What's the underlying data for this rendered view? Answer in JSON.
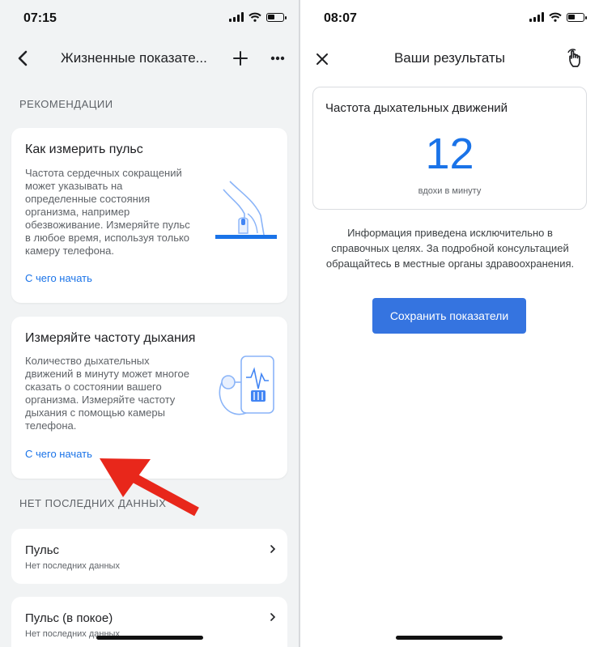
{
  "left_screen": {
    "status": {
      "time": "07:15"
    },
    "appbar": {
      "title": "Жизненные показате..."
    },
    "recommendations": {
      "label": "РЕКОМЕНДАЦИИ",
      "cards": [
        {
          "title": "Как измерить пульс",
          "body": "Частота сердечных сокращений может указывать на определенные состояния организма, например обезвоживание. Измеряйте пульс в любое время, используя только камеру телефона.",
          "link": "С чего начать"
        },
        {
          "title": "Измеряйте частоту дыхания",
          "body": "Количество дыхательных движений в минуту может многое сказать о состоянии вашего организма. Измеряйте частоту дыхания с помощью камеры телефона.",
          "link": "С чего начать"
        }
      ]
    },
    "recent": {
      "label": "НЕТ ПОСЛЕДНИХ ДАННЫХ",
      "items": [
        {
          "title": "Пульс",
          "subtitle": "Нет последних данных"
        },
        {
          "title": "Пульс (в покое)",
          "subtitle": "Нет последних данных"
        }
      ]
    }
  },
  "right_screen": {
    "status": {
      "time": "08:07"
    },
    "appbar": {
      "title": "Ваши результаты"
    },
    "result": {
      "title": "Частота дыхательных движений",
      "value": "12",
      "unit": "вдохи в минуту"
    },
    "disclaimer": "Информация приведена исключительно в справочных целях. За подробной консультацией обращайтесь в местные органы здравоохранения.",
    "save_button": "Сохранить показатели"
  },
  "colors": {
    "accent": "#1a73e8",
    "button": "#3574e0",
    "annotation_arrow": "#e8271b",
    "left_background": "#f1f3f4"
  },
  "icons": [
    "back-arrow-icon",
    "plus-icon",
    "more-icon",
    "close-icon",
    "touch-gesture-icon",
    "chevron-right-icon",
    "signal-icon",
    "wifi-icon",
    "battery-icon"
  ]
}
